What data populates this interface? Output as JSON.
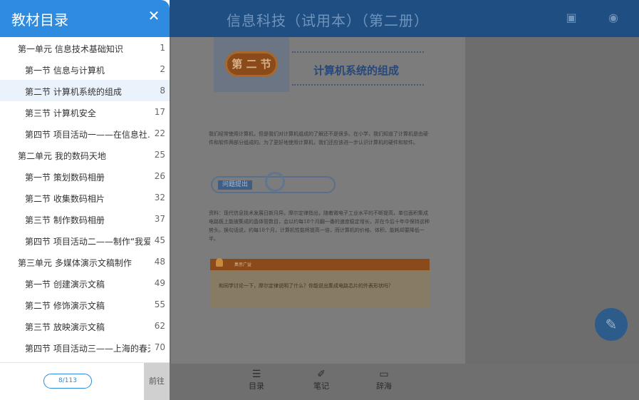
{
  "header": {
    "book_title": "信息科技（试用本）（第二册）"
  },
  "toolbar_icons": {
    "left": "page-icon",
    "right": "eye-icon"
  },
  "page": {
    "section_label": "第 二 节",
    "section_title": "计算机系统的组成",
    "intro": "我们经常使用计算机，但是我们对计算机组成的了解还不是很多。在小学，我们知道了计算机是由硬件和软件两部分组成的。为了更好地使用计算机，我们还应该进一步认识计算机的硬件和软件。",
    "question_label": "问题提出",
    "material": "资料：现代信息技术发展日新月异。摩尔定律指出，随着微电子工业水平的不断提高，单位面积集成电路板上能被集成的晶体管数目，会以约每18个月翻一番的速度稳定增长，并在今后十年中保持这种势头。换句话说，约每18个月，计算机性能将提高一倍，而计算机的价格、体积、能耗却要降低一半。",
    "note_header": "集思广益",
    "note_text": "和同学讨论一下，摩尔定律说明了什么？你能说出集成电路芯片的外表形状吗？"
  },
  "bottom_bar": {
    "items": [
      {
        "label": "目录"
      },
      {
        "label": "笔记"
      },
      {
        "label": "辞海"
      }
    ]
  },
  "drawer": {
    "title": "教材目录",
    "close": "✕",
    "items": [
      {
        "label": "第一单元 信息技术基础知识",
        "page": "1",
        "level": 1
      },
      {
        "label": "第一节 信息与计算机",
        "page": "2",
        "level": 2
      },
      {
        "label": "第二节 计算机系统的组成",
        "page": "8",
        "level": 2,
        "selected": true
      },
      {
        "label": "第三节 计算机安全",
        "page": "17",
        "level": 2
      },
      {
        "label": "第四节 项目活动一——在信息社…",
        "page": "22",
        "level": 2
      },
      {
        "label": "第二单元 我的数码天地",
        "page": "25",
        "level": 1
      },
      {
        "label": "第一节 策划数码相册",
        "page": "26",
        "level": 2
      },
      {
        "label": "第二节 收集数码相片",
        "page": "32",
        "level": 2
      },
      {
        "label": "第三节 制作数码相册",
        "page": "37",
        "level": 2
      },
      {
        "label": "第四节 项目活动二——制作“我爱.",
        "page": "45",
        "level": 2
      },
      {
        "label": "第三单元 多媒体演示文稿制作",
        "page": "48",
        "level": 1
      },
      {
        "label": "第一节 创建演示文稿",
        "page": "49",
        "level": 2
      },
      {
        "label": "第二节 修饰演示文稿",
        "page": "55",
        "level": 2
      },
      {
        "label": "第三节 放映演示文稿",
        "page": "62",
        "level": 2
      },
      {
        "label": "第四节 项目活动三——上海的春天",
        "page": "70",
        "level": 2
      }
    ],
    "page_indicator": "8/113",
    "go_label": "前往"
  }
}
